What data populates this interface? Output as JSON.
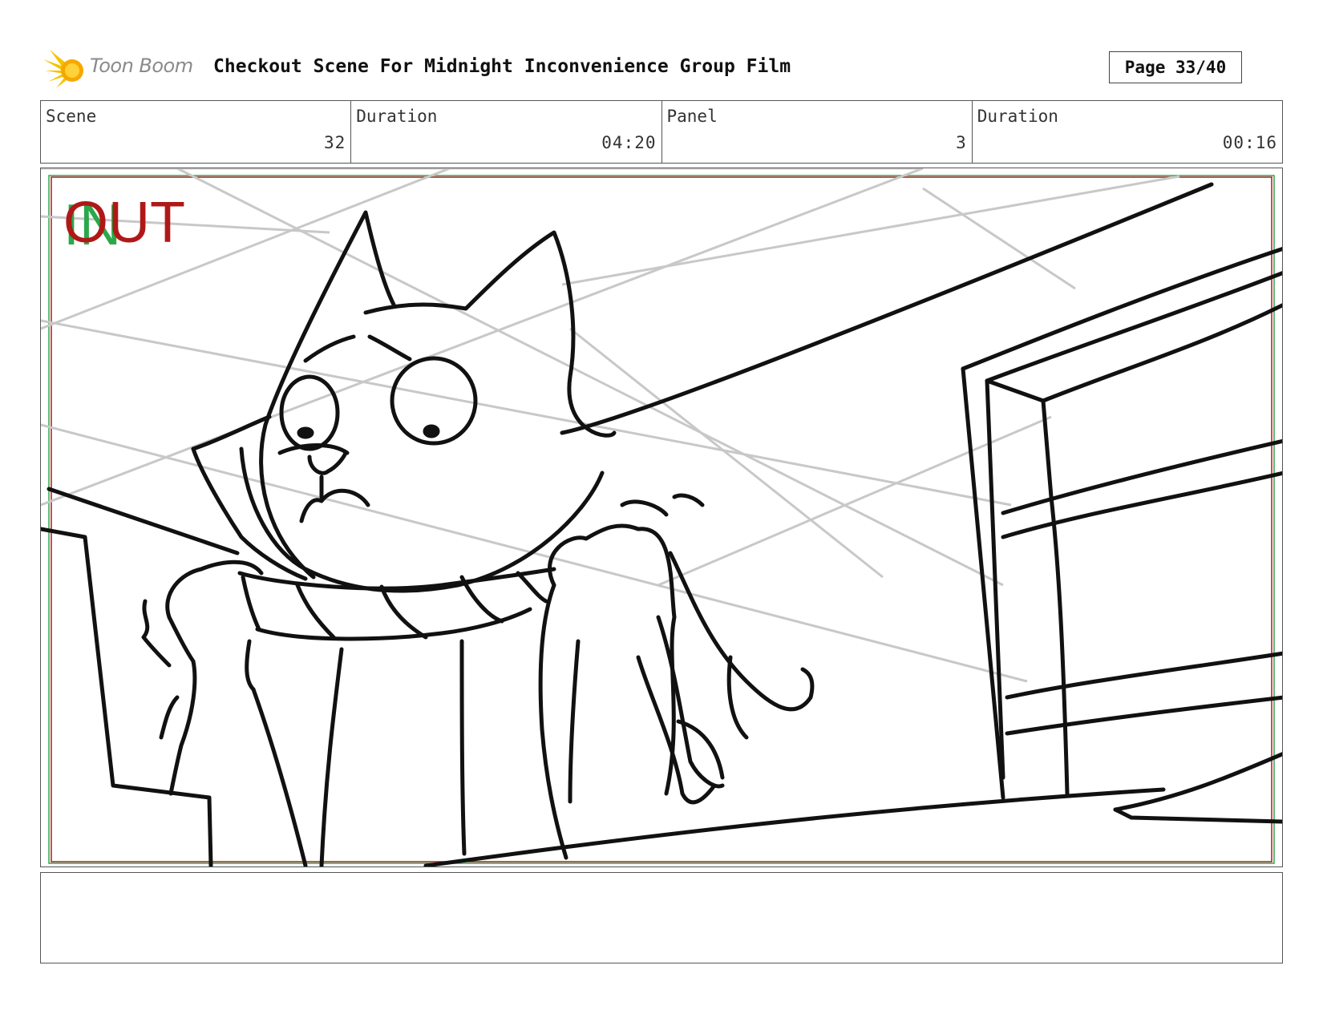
{
  "header": {
    "logo_text": "Toon Boom",
    "title": "Checkout Scene For Midnight Inconvenience Group Film",
    "page_label": "Page 33/40"
  },
  "info": {
    "scene_label": "Scene",
    "scene_value": "32",
    "scene_duration_label": "Duration",
    "scene_duration_value": "04:20",
    "panel_label": "Panel",
    "panel_value": "3",
    "panel_duration_label": "Duration",
    "panel_duration_value": "00:16"
  },
  "panel": {
    "in_marker": "IN",
    "out_marker": "OUT",
    "colors": {
      "in": "#2aa84a",
      "out": "#b01818",
      "safe_frame_outer": "#2aa84a",
      "safe_frame_inner": "#b01818"
    }
  },
  "notes": {
    "text": ""
  }
}
